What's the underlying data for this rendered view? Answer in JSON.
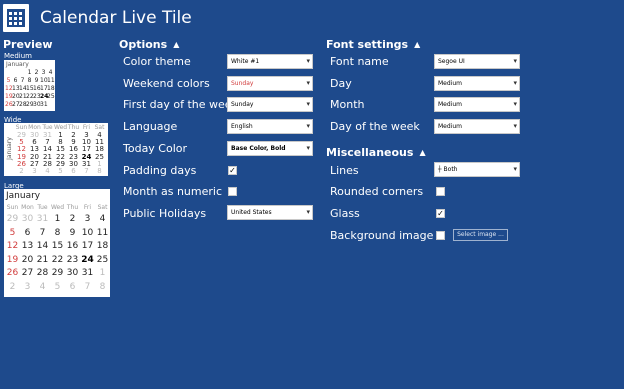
{
  "app": {
    "title": "Calendar Live Tile",
    "icon": "calendar-icon"
  },
  "preview": {
    "title": "Preview",
    "medium": {
      "caption": "Medium",
      "month": "January",
      "rows": [
        [
          "",
          "",
          "",
          "1",
          "2",
          "3",
          "4"
        ],
        [
          "5",
          "6",
          "7",
          "8",
          "9",
          "10",
          "11"
        ],
        [
          "12",
          "13",
          "14",
          "15",
          "16",
          "17",
          "18"
        ],
        [
          "19",
          "20",
          "21",
          "22",
          "23",
          "24",
          "25"
        ],
        [
          "26",
          "27",
          "28",
          "29",
          "30",
          "31",
          ""
        ]
      ]
    },
    "wide": {
      "caption": "Wide",
      "month": "January",
      "weekdays": [
        "Sun",
        "Mon",
        "Tue",
        "Wed",
        "Thu",
        "Fri",
        "Sat"
      ],
      "rows": [
        [
          "29",
          "30",
          "31",
          "1",
          "2",
          "3",
          "4"
        ],
        [
          "5",
          "6",
          "7",
          "8",
          "9",
          "10",
          "11"
        ],
        [
          "12",
          "13",
          "14",
          "15",
          "16",
          "17",
          "18"
        ],
        [
          "19",
          "20",
          "21",
          "22",
          "23",
          "24",
          "25"
        ],
        [
          "26",
          "27",
          "28",
          "29",
          "30",
          "31",
          "1"
        ],
        [
          "2",
          "3",
          "4",
          "5",
          "6",
          "7",
          "8"
        ]
      ]
    },
    "large": {
      "caption": "Large",
      "month": "January",
      "weekdays": [
        "Sun",
        "Mon",
        "Tue",
        "Wed",
        "Thu",
        "Fri",
        "Sat"
      ],
      "rows": [
        [
          "29",
          "30",
          "31",
          "1",
          "2",
          "3",
          "4"
        ],
        [
          "5",
          "6",
          "7",
          "8",
          "9",
          "10",
          "11"
        ],
        [
          "12",
          "13",
          "14",
          "15",
          "16",
          "17",
          "18"
        ],
        [
          "19",
          "20",
          "21",
          "22",
          "23",
          "24",
          "25"
        ],
        [
          "26",
          "27",
          "28",
          "29",
          "30",
          "31",
          "1"
        ],
        [
          "2",
          "3",
          "4",
          "5",
          "6",
          "7",
          "8"
        ]
      ]
    }
  },
  "options": {
    "title": "Options",
    "color_theme": {
      "label": "Color theme",
      "value": "White #1"
    },
    "weekend_colors": {
      "label": "Weekend colors",
      "value": "Sunday"
    },
    "first_day": {
      "label": "First day of the week",
      "value": "Sunday"
    },
    "language": {
      "label": "Language",
      "value": "English"
    },
    "today_color": {
      "label": "Today Color",
      "value": "Base Color, Bold"
    },
    "padding_days": {
      "label": "Padding days",
      "checked": true
    },
    "month_numeric": {
      "label": "Month as numeric",
      "checked": false
    },
    "public_holidays": {
      "label": "Public Holidays",
      "value": "United States"
    }
  },
  "font_settings": {
    "title": "Font settings",
    "font_name": {
      "label": "Font name",
      "value": "Segoe UI"
    },
    "day": {
      "label": "Day",
      "value": "Medium"
    },
    "month": {
      "label": "Month",
      "value": "Medium"
    },
    "day_of_week": {
      "label": "Day of the week",
      "value": "Medium"
    }
  },
  "misc": {
    "title": "Miscellaneous",
    "lines": {
      "label": "Lines",
      "value": "Both",
      "prefix": "┼"
    },
    "rounded_corners": {
      "label": "Rounded corners",
      "checked": false
    },
    "glass": {
      "label": "Glass",
      "checked": true
    },
    "background_image": {
      "label": "Background image",
      "checked": false,
      "button": "Select image ..."
    }
  },
  "colors": {
    "background": "#1e4a8c",
    "weekend": "#d13c3c"
  }
}
